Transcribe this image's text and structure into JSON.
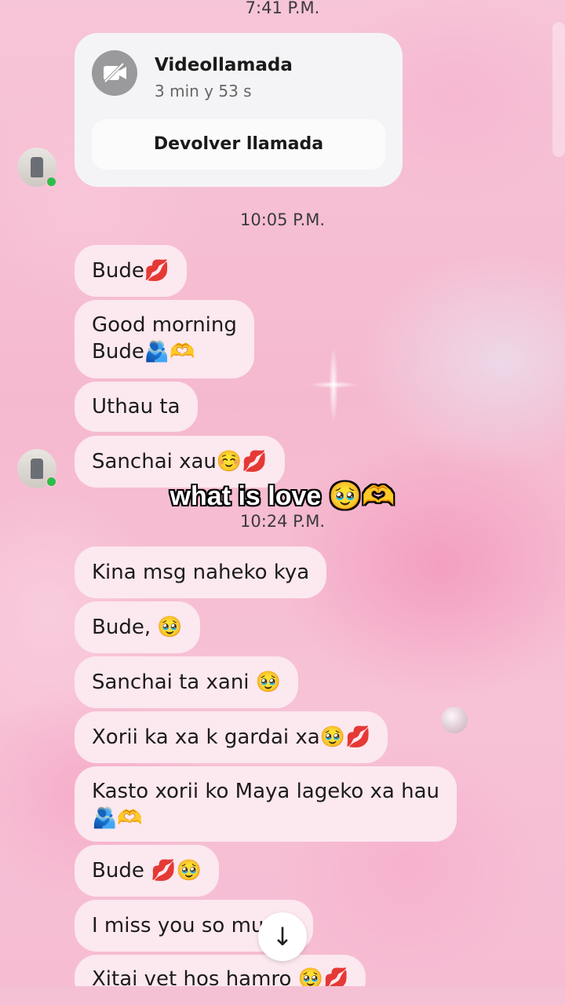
{
  "times": {
    "t1": "7:41 P.M.",
    "t2": "10:05 P.M.",
    "t3": "10:24 P.M."
  },
  "call": {
    "title": "Videollamada",
    "duration": "3 min y 53 s",
    "button": "Devolver llamada",
    "icon": "video-off-icon"
  },
  "messages": [
    "Bude💋",
    "Good morning\nBude🫂🫶",
    "Uthau ta",
    "Sanchai xau☺️💋",
    "Kina msg naheko kya",
    "Bude, 🥹",
    "Sanchai ta xani 🥹",
    "Xorii ka xa k gardai xa🥹💋",
    "Kasto xorii ko Maya lageko xa hau\n🫂🫶",
    "Bude 💋🥹",
    "I miss you so mu   🥹",
    "Xitai vet hos hamro 🥹💋"
  ],
  "overlay_caption": "what is love 🥹🫶",
  "scroll_down_icon": "arrow-down-icon",
  "colors": {
    "bubble": "#fce8ef",
    "online": "#2bbf4a"
  }
}
